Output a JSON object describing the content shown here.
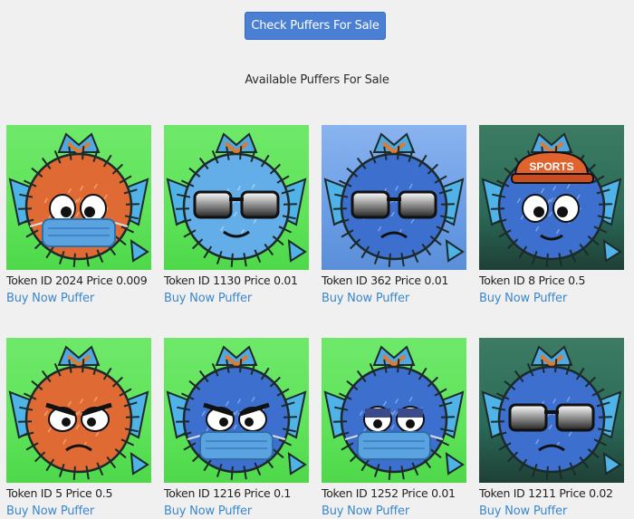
{
  "header": {
    "button_label": "Check Puffers For Sale"
  },
  "title": "Available Puffers For Sale",
  "buy_label": "Buy Now Puffer",
  "colors": {
    "button_bg": "#4a7fd4",
    "link": "#3b87c9",
    "page_bg": "#f1f0f1"
  },
  "puffers": [
    {
      "caption": "Token ID 2024 Price 0.009",
      "bg": "green",
      "body": "orange",
      "eyes": "normal",
      "accessory": "mask"
    },
    {
      "caption": "Token ID 1130 Price 0.01",
      "bg": "green",
      "body": "lightblue",
      "eyes": "sunglasses",
      "accessory": "smile"
    },
    {
      "caption": "Token ID 362 Price 0.01",
      "bg": "blue",
      "body": "blue",
      "eyes": "sunglasses",
      "accessory": "frown"
    },
    {
      "caption": "Token ID 8 Price 0.5",
      "bg": "teal",
      "body": "blue",
      "eyes": "normal",
      "accessory": "hat",
      "hat_text": "SPORTS"
    },
    {
      "caption": "Token ID 5 Price 0.5",
      "bg": "green",
      "body": "orange",
      "eyes": "angry",
      "accessory": "frown"
    },
    {
      "caption": "Token ID 1216 Price 0.1",
      "bg": "green",
      "body": "blue",
      "eyes": "angry",
      "accessory": "mask"
    },
    {
      "caption": "Token ID 1252 Price 0.01",
      "bg": "green",
      "body": "blue",
      "eyes": "flat",
      "accessory": "mask"
    },
    {
      "caption": "Token ID 1211 Price 0.02",
      "bg": "teal",
      "body": "blue",
      "eyes": "sunglasses",
      "accessory": "frown"
    }
  ]
}
